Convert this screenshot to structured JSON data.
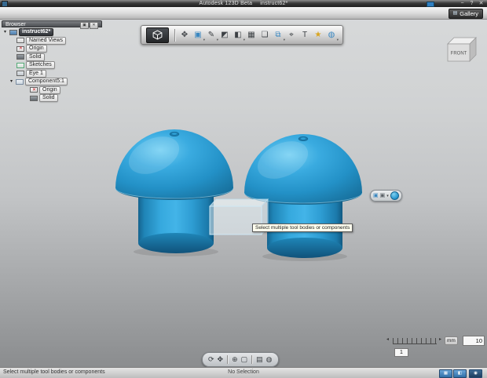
{
  "window": {
    "title": "Autodesk 123D Beta",
    "doc_title": "instruct62*",
    "minimize_glyph": "−",
    "help_glyph": "?",
    "close_glyph": "✕"
  },
  "menubar": {
    "gallery_label": "Gallery",
    "gallery_icon_glyph": "▤"
  },
  "browser": {
    "title": "Browser",
    "collapse_icon_glyph": "▣",
    "close_icon_glyph": "✕",
    "expanded_arrow_glyph": "▾",
    "items": [
      {
        "label": "instruct62*",
        "icon": "document-icon"
      },
      {
        "label": "Named Views",
        "icon": "views-icon"
      },
      {
        "label": "Origin",
        "icon": "origin-icon"
      },
      {
        "label": "Solid",
        "icon": "solid-icon"
      },
      {
        "label": "Sketches",
        "icon": "sketches-icon"
      },
      {
        "label": "Eye 1",
        "icon": "body-icon"
      },
      {
        "label": "Component5:1",
        "icon": "component-icon"
      },
      {
        "label": "Origin",
        "icon": "origin-icon"
      },
      {
        "label": "Solid",
        "icon": "solid-icon"
      }
    ]
  },
  "toolbar": {
    "app_button_icon": "cube-wireframe-icon",
    "tools": [
      {
        "name": "transform-tool",
        "glyph": "✥"
      },
      {
        "name": "primitives-tool",
        "glyph": "▣"
      },
      {
        "name": "sketch-tool",
        "glyph": "✎"
      },
      {
        "name": "construct-tool",
        "glyph": "◩"
      },
      {
        "name": "modify-tool",
        "glyph": "◧"
      },
      {
        "name": "pattern-tool",
        "glyph": "▦"
      },
      {
        "name": "grouping-tool",
        "glyph": "❏"
      },
      {
        "name": "combine-tool",
        "glyph": "⧉"
      },
      {
        "name": "measure-tool",
        "glyph": "⌖"
      },
      {
        "name": "text-tool",
        "glyph": "T"
      },
      {
        "name": "snap-tool",
        "glyph": "★"
      },
      {
        "name": "material-tool",
        "glyph": "◍"
      }
    ]
  },
  "viewcube": {
    "front_label": "FRONT"
  },
  "selection_minibar": {
    "icons": [
      {
        "name": "target-body-icon",
        "glyph": "▣"
      },
      {
        "name": "tool-body-icon",
        "glyph": "▣"
      },
      {
        "name": "dropdown-icon",
        "glyph": "▾"
      }
    ]
  },
  "tooltip": {
    "text": "Select multiple tool bodies or components"
  },
  "navbar": {
    "dropdown_glyph": "▾",
    "icons": [
      {
        "name": "orbit-icon",
        "glyph": "⟳"
      },
      {
        "name": "pan-icon",
        "glyph": "✥"
      },
      {
        "name": "zoom-icon",
        "glyph": "⊕"
      },
      {
        "name": "fit-view-icon",
        "glyph": "▢"
      },
      {
        "name": "display-settings-icon",
        "glyph": "▤"
      },
      {
        "name": "material-view-icon",
        "glyph": "◍"
      }
    ]
  },
  "scale_widget": {
    "left_arrow_glyph": "◂",
    "right_arrow_glyph": "▸",
    "unit_label": "mm",
    "value": "10",
    "grid_value": "1"
  },
  "statusbar": {
    "hint": "Select multiple tool bodies or components",
    "selection": "No Selection",
    "buttons": [
      {
        "name": "grid-toggle",
        "glyph": "▦"
      },
      {
        "name": "snap-toggle",
        "glyph": "◧"
      },
      {
        "name": "help-toggle",
        "glyph": "◉"
      }
    ]
  },
  "colors": {
    "body_blue": "#2aa3dc",
    "accent_blue": "#3a87c0"
  }
}
